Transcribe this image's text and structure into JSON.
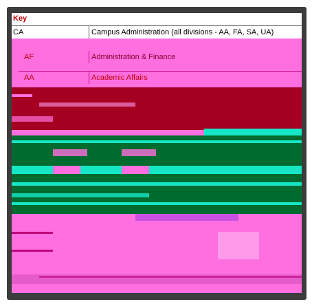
{
  "key": {
    "title": "Key",
    "rows": [
      {
        "code": "CA",
        "name": "Campus Administration  (all divisions - AA, FA, SA, UA)"
      },
      {
        "code": "AF",
        "name": "Administration & Finance"
      },
      {
        "code": "AA",
        "name": "Academic Affairs"
      }
    ]
  },
  "colors": {
    "frame": "#3c3c3c",
    "magenta": "#ff6fe0",
    "crimson": "#a50021",
    "teal": "#17e6c6",
    "green": "#006b2e",
    "text_red": "#c00000"
  }
}
